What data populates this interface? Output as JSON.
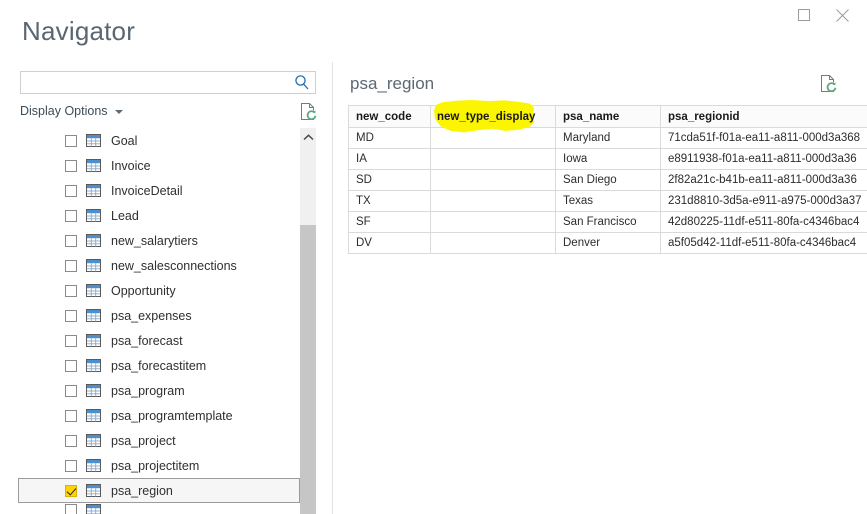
{
  "window": {
    "maximize_label": "Maximize",
    "close_label": "Close"
  },
  "dialog": {
    "title": "Navigator"
  },
  "search": {
    "value": "",
    "placeholder": "",
    "icon": "search-icon"
  },
  "display_options": {
    "label": "Display Options",
    "caret_icon": "chevron-down-icon",
    "refresh_icon": "refresh-document-icon"
  },
  "tree": {
    "items": [
      {
        "label": "Goal",
        "checked": false,
        "selected": false
      },
      {
        "label": "Invoice",
        "checked": false,
        "selected": false
      },
      {
        "label": "InvoiceDetail",
        "checked": false,
        "selected": false
      },
      {
        "label": "Lead",
        "checked": false,
        "selected": false
      },
      {
        "label": "new_salarytiers",
        "checked": false,
        "selected": false
      },
      {
        "label": "new_salesconnections",
        "checked": false,
        "selected": false
      },
      {
        "label": "Opportunity",
        "checked": false,
        "selected": false
      },
      {
        "label": "psa_expenses",
        "checked": false,
        "selected": false
      },
      {
        "label": "psa_forecast",
        "checked": false,
        "selected": false
      },
      {
        "label": "psa_forecastitem",
        "checked": false,
        "selected": false
      },
      {
        "label": "psa_program",
        "checked": false,
        "selected": false
      },
      {
        "label": "psa_programtemplate",
        "checked": false,
        "selected": false
      },
      {
        "label": "psa_project",
        "checked": false,
        "selected": false
      },
      {
        "label": "psa_projectitem",
        "checked": false,
        "selected": false
      },
      {
        "label": "psa_region",
        "checked": true,
        "selected": true
      },
      {
        "label": "",
        "checked": false,
        "selected": false
      }
    ],
    "scrollbar": {
      "up_arrow_icon": "chevron-up-icon"
    }
  },
  "preview": {
    "title": "psa_region",
    "refresh_icon": "refresh-document-icon",
    "columns": [
      "new_code",
      "new_type_display",
      "psa_name",
      "psa_regionid"
    ],
    "highlighted_column": "new_type_display",
    "rows": [
      {
        "new_code": "MD",
        "new_type_display": "",
        "psa_name": "Maryland",
        "psa_regionid": "71cda51f-f01a-ea11-a811-000d3a368"
      },
      {
        "new_code": "IA",
        "new_type_display": "",
        "psa_name": "Iowa",
        "psa_regionid": "e8911938-f01a-ea11-a811-000d3a36"
      },
      {
        "new_code": "SD",
        "new_type_display": "",
        "psa_name": "San Diego",
        "psa_regionid": "2f82a21c-b41b-ea11-a811-000d3a36"
      },
      {
        "new_code": "TX",
        "new_type_display": "",
        "psa_name": "Texas",
        "psa_regionid": "231d8810-3d5a-e911-a975-000d3a37"
      },
      {
        "new_code": "SF",
        "new_type_display": "",
        "psa_name": "San Francisco",
        "psa_regionid": "42d80225-11df-e511-80fa-c4346bac4"
      },
      {
        "new_code": "DV",
        "new_type_display": "",
        "psa_name": "Denver",
        "psa_regionid": "a5f05d42-11df-e511-80fa-c4346bac4"
      }
    ]
  },
  "colors": {
    "highlighter": "#fbf500",
    "checkbox_checked": "#ffd400",
    "search_icon": "#1f6fb4",
    "title_text": "#5a6672",
    "table_icon_header": "#4a8fd0",
    "refresh_green": "#5aa77f"
  }
}
